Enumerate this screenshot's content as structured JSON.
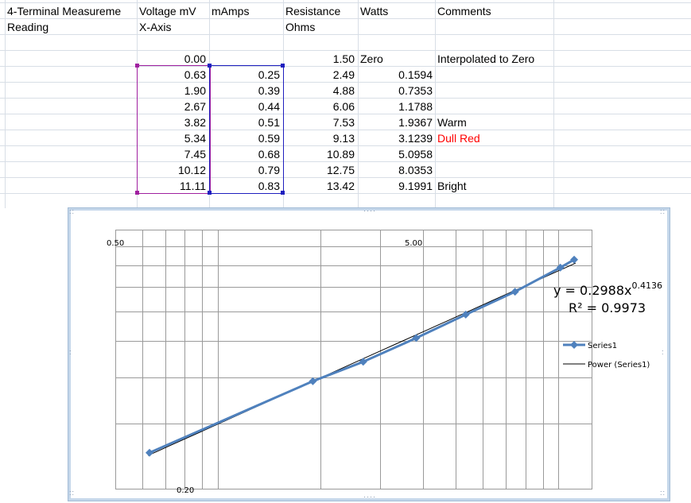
{
  "sheet": {
    "header1": [
      "4-Terminal Measureme",
      "Voltage mV",
      "mAmps",
      "Resistance",
      "Watts",
      "Comments"
    ],
    "header2": [
      "Reading",
      "X-Axis",
      "",
      "Ohms",
      "",
      ""
    ],
    "rows": [
      {
        "voltage": "0.00",
        "mamps": "",
        "resistance": "1.50",
        "watts": "Zero",
        "comment": "Interpolated to Zero",
        "comment_color": "#000000"
      },
      {
        "voltage": "0.63",
        "mamps": "0.25",
        "resistance": "2.49",
        "watts": "0.1594",
        "comment": "",
        "comment_color": "#000000"
      },
      {
        "voltage": "1.90",
        "mamps": "0.39",
        "resistance": "4.88",
        "watts": "0.7353",
        "comment": "",
        "comment_color": "#000000"
      },
      {
        "voltage": "2.67",
        "mamps": "0.44",
        "resistance": "6.06",
        "watts": "1.1788",
        "comment": "",
        "comment_color": "#000000"
      },
      {
        "voltage": "3.82",
        "mamps": "0.51",
        "resistance": "7.53",
        "watts": "1.9367",
        "comment": "Warm",
        "comment_color": "#000000"
      },
      {
        "voltage": "5.34",
        "mamps": "0.59",
        "resistance": "9.13",
        "watts": "3.1239",
        "comment": "Dull Red",
        "comment_color": "#ff0000"
      },
      {
        "voltage": "7.45",
        "mamps": "0.68",
        "resistance": "10.89",
        "watts": "5.0958",
        "comment": "",
        "comment_color": "#000000"
      },
      {
        "voltage": "10.12",
        "mamps": "0.79",
        "resistance": "12.75",
        "watts": "8.0353",
        "comment": "",
        "comment_color": "#000000"
      },
      {
        "voltage": "11.11",
        "mamps": "0.83",
        "resistance": "13.42",
        "watts": "9.1991",
        "comment": "Bright",
        "comment_color": "#000000"
      }
    ],
    "selection_colors": {
      "x_range": "#a020a0",
      "y_range": "#1f1fbf"
    }
  },
  "chart_data": {
    "type": "scatter",
    "x_scale": "log",
    "y_scale": "log",
    "xlim": [
      0.5,
      12.5
    ],
    "ylim": [
      0.2,
      1.0
    ],
    "x_tick_labels": [
      "0.50",
      "5.00"
    ],
    "y_tick_labels": [
      "0.20"
    ],
    "grid": true,
    "legend_position": "right",
    "series": [
      {
        "name": "Series1",
        "color": "#4f81bd",
        "marker": "diamond",
        "x": [
          0.63,
          1.9,
          2.67,
          3.82,
          5.34,
          7.45,
          10.12,
          11.11
        ],
        "y": [
          0.25,
          0.39,
          0.44,
          0.51,
          0.59,
          0.68,
          0.79,
          0.83
        ]
      }
    ],
    "trendline": {
      "name": "Power (Series1)",
      "color": "#000000",
      "a": 0.2988,
      "b": 0.4136,
      "equation": "y = 0.2988x",
      "exponent": "0.4136",
      "r2": "R² = 0.9973"
    }
  }
}
